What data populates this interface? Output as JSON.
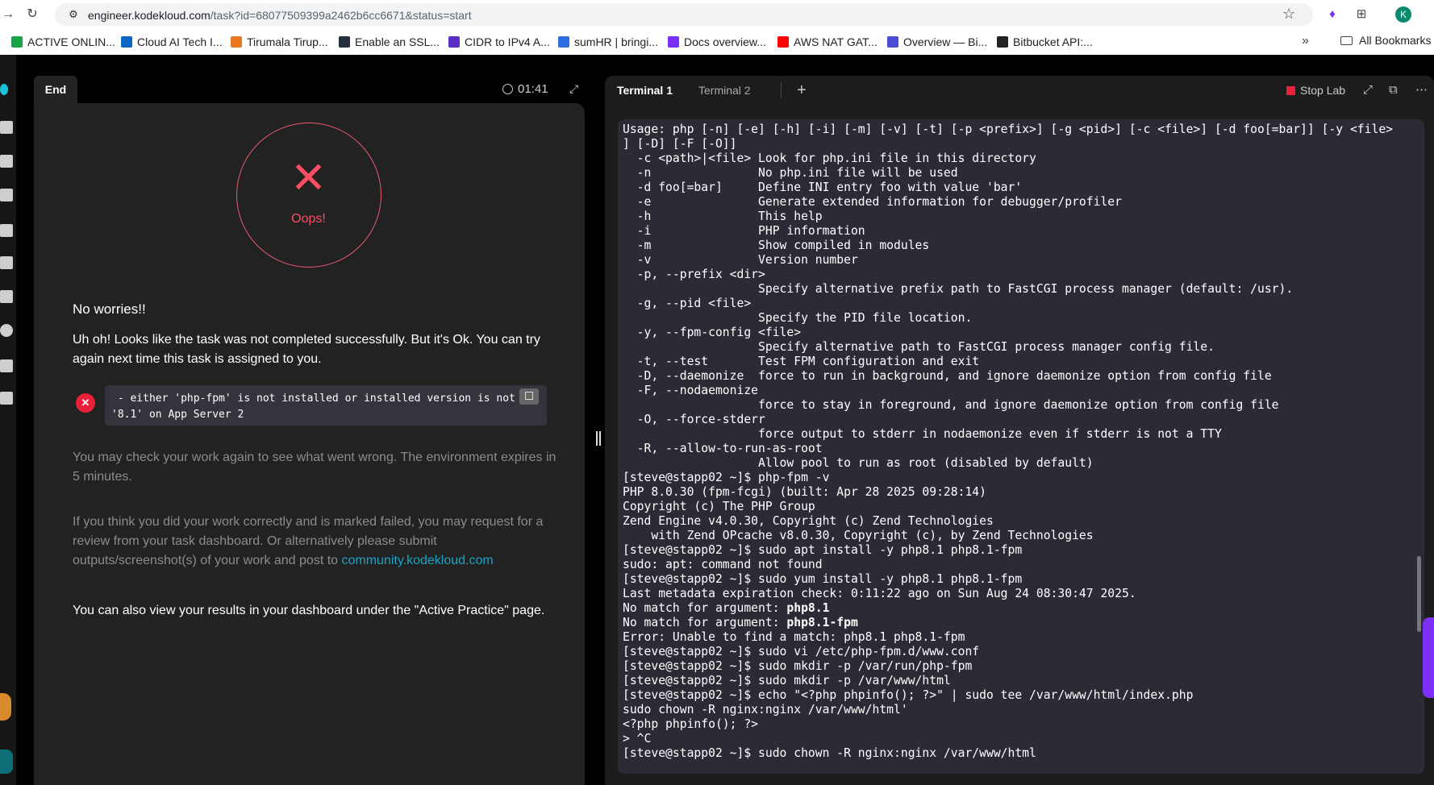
{
  "browser": {
    "url_domain": "engineer.kodekloud.com",
    "url_path": "/task?id=68077509399a2462b6cc6671&status=start",
    "profile_initial": "K",
    "bookmarks": [
      {
        "label": "ACTIVE ONLIN...",
        "color": "#1aa34a"
      },
      {
        "label": "Cloud AI Tech I...",
        "color": "#0a66c2"
      },
      {
        "label": "Tirumala Tirup...",
        "color": "#e87722"
      },
      {
        "label": "Enable an SSL...",
        "color": "#232f3e"
      },
      {
        "label": "CIDR to IPv4 A...",
        "color": "#5b2dc9"
      },
      {
        "label": "sumHR | bringi...",
        "color": "#2d6cdf"
      },
      {
        "label": "Docs overview...",
        "color": "#7b2ff7"
      },
      {
        "label": "AWS NAT GAT...",
        "color": "#ff0000"
      },
      {
        "label": "Overview — Bi...",
        "color": "#4b4bd6"
      },
      {
        "label": "Bitbucket API:...",
        "color": "#222222"
      }
    ],
    "all_bookmarks": "All Bookmarks"
  },
  "left": {
    "tab_label": "End",
    "timer": "01:41",
    "oops": "Oops!",
    "heading": "No worries!!",
    "message": "Uh oh! Looks like the task was not completed successfully. But it's Ok. You can try again next time this task is assigned to you.",
    "error": " - either 'php-fpm' is not installed or installed version is not\n'8.1' on App Server 2",
    "may_check": "You may check your work again to see what went wrong. The environment expires in 5 minutes.",
    "if_you": "If you think you did your work correctly and is marked failed, you may request for a review from your task dashboard. Or alternatively please submit outputs/screenshot(s) of your work and post to ",
    "community_link": "community.kodekloud.com",
    "also_view": "You can also view your results in your dashboard under the \"Active Practice\" page."
  },
  "right": {
    "tab1": "Terminal 1",
    "tab2": "Terminal 2",
    "stop_lab": "Stop Lab",
    "terminal_lines": [
      "Usage: php [-n] [-e] [-h] [-i] [-m] [-v] [-t] [-p <prefix>] [-g <pid>] [-c <file>] [-d foo[=bar]] [-y <file>",
      "] [-D] [-F [-O]]",
      "  -c <path>|<file> Look for php.ini file in this directory",
      "  -n               No php.ini file will be used",
      "  -d foo[=bar]     Define INI entry foo with value 'bar'",
      "  -e               Generate extended information for debugger/profiler",
      "  -h               This help",
      "  -i               PHP information",
      "  -m               Show compiled in modules",
      "  -v               Version number",
      "  -p, --prefix <dir>",
      "                   Specify alternative prefix path to FastCGI process manager (default: /usr).",
      "  -g, --pid <file>",
      "                   Specify the PID file location.",
      "  -y, --fpm-config <file>",
      "                   Specify alternative path to FastCGI process manager config file.",
      "  -t, --test       Test FPM configuration and exit",
      "  -D, --daemonize  force to run in background, and ignore daemonize option from config file",
      "  -F, --nodaemonize",
      "                   force to stay in foreground, and ignore daemonize option from config file",
      "  -O, --force-stderr",
      "                   force output to stderr in nodaemonize even if stderr is not a TTY",
      "  -R, --allow-to-run-as-root",
      "                   Allow pool to run as root (disabled by default)",
      "[steve@stapp02 ~]$ php-fpm -v",
      "PHP 8.0.30 (fpm-fcgi) (built: Apr 28 2025 09:28:14)",
      "Copyright (c) The PHP Group",
      "Zend Engine v4.0.30, Copyright (c) Zend Technologies",
      "    with Zend OPcache v8.0.30, Copyright (c), by Zend Technologies",
      "[steve@stapp02 ~]$ sudo apt install -y php8.1 php8.1-fpm",
      "sudo: apt: command not found",
      "[steve@stapp02 ~]$ sudo yum install -y php8.1 php8.1-fpm",
      "Last metadata expiration check: 0:11:22 ago on Sun Aug 24 08:30:47 2025.",
      "No match for argument: php8.1",
      "No match for argument: php8.1-fpm",
      "Error: Unable to find a match: php8.1 php8.1-fpm",
      "[steve@stapp02 ~]$ sudo vi /etc/php-fpm.d/www.conf",
      "[steve@stapp02 ~]$ sudo mkdir -p /var/run/php-fpm",
      "[steve@stapp02 ~]$ sudo mkdir -p /var/www/html",
      "[steve@stapp02 ~]$ echo \"<?php phpinfo(); ?>\" | sudo tee /var/www/html/index.php",
      "sudo chown -R nginx:nginx /var/www/html'",
      "<?php phpinfo(); ?>",
      "> ^C",
      "[steve@stapp02 ~]$ sudo chown -R nginx:nginx /var/www/html"
    ]
  }
}
